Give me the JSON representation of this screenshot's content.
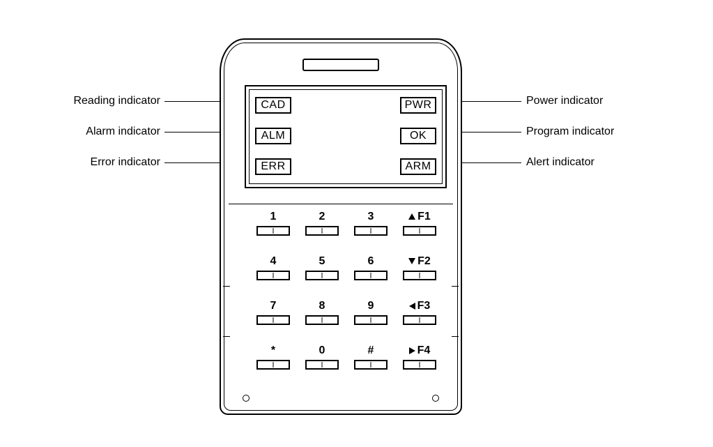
{
  "indicators": {
    "cad": "CAD",
    "alm": "ALM",
    "err": "ERR",
    "pwr": "PWR",
    "ok": "OK",
    "arm": "ARM"
  },
  "callouts": {
    "reading": "Reading indicator",
    "alarm": "Alarm indicator",
    "error": "Error indicator",
    "power": "Power indicator",
    "program": "Program indicator",
    "alert": "Alert indicator"
  },
  "keys": {
    "k1": "1",
    "k2": "2",
    "k3": "3",
    "k4": "4",
    "k5": "5",
    "k6": "6",
    "k7": "7",
    "k8": "8",
    "k9": "9",
    "kstar": "*",
    "k0": "0",
    "khash": "#",
    "f1": "F1",
    "f2": "F2",
    "f3": "F3",
    "f4": "F4"
  }
}
